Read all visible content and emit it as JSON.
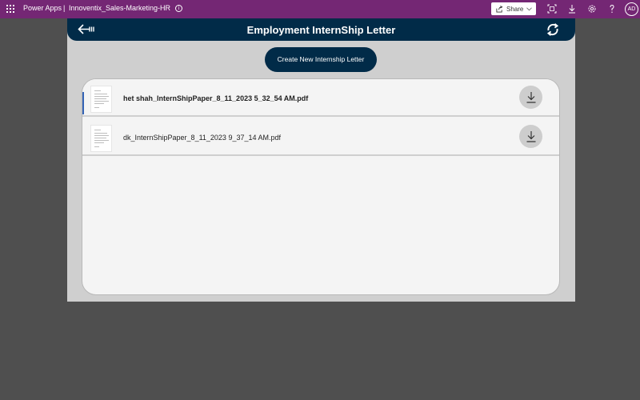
{
  "topbar": {
    "app_name": "Power Apps",
    "separator": "|",
    "environment": "Innoventix_Sales-Marketing-HR",
    "info_glyph": "i",
    "share_label": "Share",
    "avatar_initials": "AD",
    "icons": [
      "waffle-icon",
      "info-icon",
      "share-icon",
      "fit-screen-icon",
      "download-icon",
      "settings-icon",
      "help-icon"
    ]
  },
  "header": {
    "title": "Employment InternShip Letter",
    "back_icon": "back-arrow-icon",
    "refresh_icon": "refresh-icon"
  },
  "actions": {
    "create_label": "Create New Internship Letter"
  },
  "files": [
    {
      "name": "het shah_InternShipPaper_8_11_2023 5_32_54 AM.pdf",
      "selected": true
    },
    {
      "name": "dk_InternShipPaper_8_11_2023 9_37_14 AM.pdf",
      "selected": false
    }
  ],
  "colors": {
    "topbar": "#742774",
    "header": "#012b48",
    "accent": "#3564b6"
  }
}
